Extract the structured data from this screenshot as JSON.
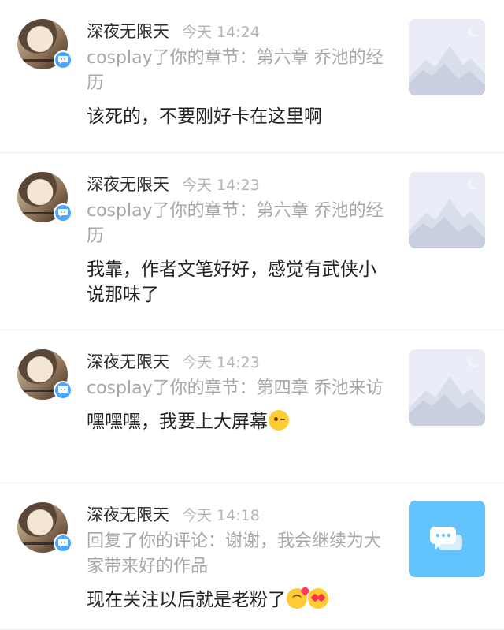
{
  "notifications": [
    {
      "username": "深夜无限天",
      "time": "今天 14:24",
      "notice": "cosplay了你的章节：第六章  乔池的经历",
      "comment": "该死的，不要刚好卡在这里啊",
      "emojis": [],
      "thumb": "mountain-placeholder-icon"
    },
    {
      "username": "深夜无限天",
      "time": "今天 14:23",
      "notice": "cosplay了你的章节：第六章  乔池的经历",
      "comment": "我靠，作者文笔好好，感觉有武侠小说那味了",
      "emojis": [],
      "thumb": "mountain-placeholder-icon"
    },
    {
      "username": "深夜无限天",
      "time": "今天 14:23",
      "notice": "cosplay了你的章节：第四章  乔池来访",
      "comment": "嘿嘿嘿，我要上大屏幕",
      "emojis": [
        "wink-emoji"
      ],
      "thumb": "mountain-placeholder-icon"
    },
    {
      "username": "深夜无限天",
      "time": "今天 14:18",
      "notice": "回复了你的评论：谢谢，我会继续为大家带来好的作品",
      "comment": "现在关注以后就是老粉了",
      "emojis": [
        "kiss-emoji",
        "heart-eyes-emoji"
      ],
      "thumb": "chat-bubbles-icon"
    }
  ],
  "colors": {
    "badge": "#4aa6ff",
    "chat_thumb_bg": "#62c3ff",
    "muted_text": "#a7a7a7"
  }
}
